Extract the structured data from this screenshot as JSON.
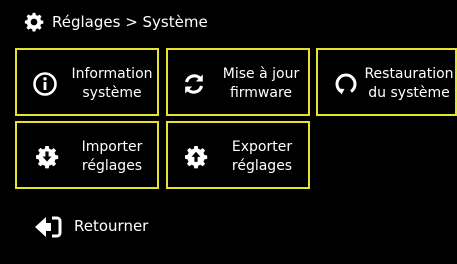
{
  "header": {
    "title": "Réglages > Système",
    "icon": "gear-icon"
  },
  "tiles": [
    {
      "line1": "Information",
      "line2": "système",
      "icon": "info-circle-icon"
    },
    {
      "line1": "Mise à jour",
      "line2": "firmware",
      "icon": "refresh-icon"
    },
    {
      "line1": "Restauration",
      "line2": "du système",
      "icon": "restore-icon"
    },
    {
      "line1": "Importer",
      "line2": "réglages",
      "icon": "gear-import-icon"
    },
    {
      "line1": "Exporter",
      "line2": "réglages",
      "icon": "gear-export-icon"
    }
  ],
  "back": {
    "label": "Retourner",
    "icon": "back-arrow-icon"
  },
  "colors": {
    "background": "#000000",
    "text": "#ffffff",
    "accent_border": "#e6e22e"
  }
}
